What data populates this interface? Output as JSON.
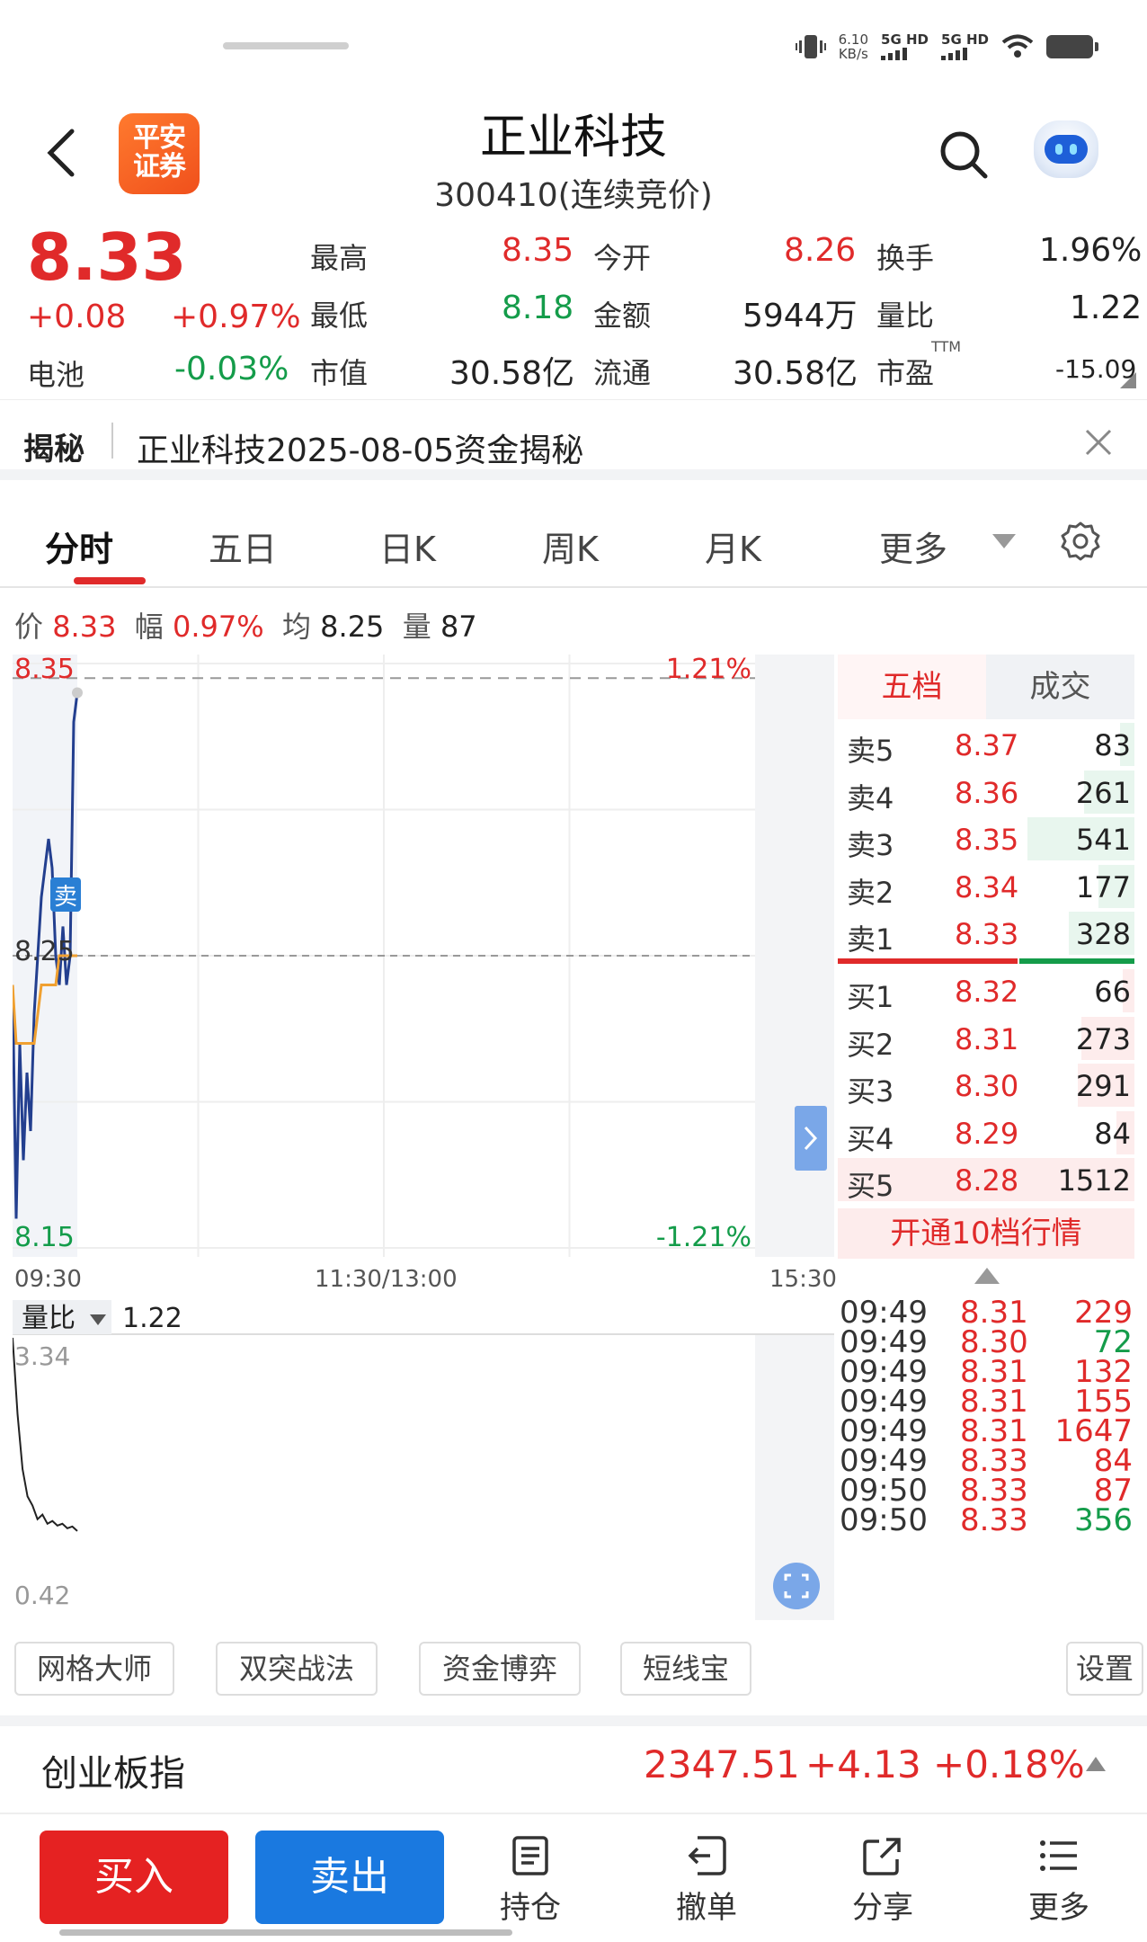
{
  "status": {
    "speed_value": "6.10",
    "speed_unit": "KB/s",
    "net1": "5G HD",
    "net2": "5G HD"
  },
  "header": {
    "logo_text_1": "平安",
    "logo_text_2": "证券",
    "title": "正业科技",
    "subtitle": "300410(连续竞价)"
  },
  "quote": {
    "price": "8.33",
    "change": "+0.08",
    "change_pct": "+0.97%",
    "battery_label": "电池",
    "battery_value": "-0.03%",
    "high_label": "最高",
    "high": "8.35",
    "low_label": "最低",
    "low": "8.18",
    "mcap_label": "市值",
    "mcap": "30.58亿",
    "open_label": "今开",
    "open": "8.26",
    "amount_label": "金额",
    "amount": "5944万",
    "float_label": "流通",
    "float": "30.58亿",
    "turnover_label": "换手",
    "turnover": "1.96%",
    "vol_ratio_label": "量比",
    "vol_ratio": "1.22",
    "pe_label": "市盈",
    "pe_sup": "TTM",
    "pe": "-15.09"
  },
  "banner": {
    "tag": "揭秘",
    "text": "正业科技2025-08-05资金揭秘"
  },
  "tabs": [
    "分时",
    "五日",
    "日K",
    "周K",
    "月K",
    "更多"
  ],
  "infoline": {
    "price_label": "价",
    "price": "8.33",
    "amp_label": "幅",
    "amp": "0.97%",
    "avg_label": "均",
    "avg": "8.25",
    "vol_label": "量",
    "vol": "87"
  },
  "chart_data": {
    "type": "line",
    "title": "",
    "y_range": [
      8.15,
      8.35
    ],
    "y_top_label": "8.35",
    "y_mid_label": "8.25",
    "y_bot_label": "8.15",
    "pct_top_label": "1.21%",
    "pct_bot_label": "-1.21%",
    "x_labels": [
      "09:30",
      "11:30/13:00",
      "15:30"
    ],
    "sell_marker": "卖",
    "series": [
      {
        "values": [
          8.24,
          8.16,
          8.22,
          8.18,
          8.21,
          8.19,
          8.23,
          8.25,
          8.27,
          8.28,
          8.29,
          8.28,
          8.25,
          8.24,
          8.26,
          8.24,
          8.25,
          8.33,
          8.34
        ]
      },
      {
        "values": [
          8.24,
          8.22,
          8.22,
          8.22,
          8.22,
          8.22,
          8.22,
          8.23,
          8.24,
          8.24,
          8.24,
          8.24,
          8.24,
          8.25,
          8.25,
          8.25,
          8.25,
          8.25,
          8.25
        ]
      }
    ]
  },
  "vol_chart": {
    "label": "量比",
    "value": "1.22",
    "top": "3.34",
    "bottom": "0.42",
    "range": [
      0.42,
      3.34
    ],
    "values": [
      3.34,
      2.5,
      1.9,
      1.6,
      1.5,
      1.35,
      1.4,
      1.3,
      1.33,
      1.28,
      1.3,
      1.25,
      1.27,
      1.22
    ]
  },
  "orderbook": {
    "tabs": [
      "五档",
      "成交"
    ],
    "asks": [
      {
        "label": "卖5",
        "price": "8.37",
        "vol": "83",
        "depth": 0.05
      },
      {
        "label": "卖4",
        "price": "8.36",
        "vol": "261",
        "depth": 0.17
      },
      {
        "label": "卖3",
        "price": "8.35",
        "vol": "541",
        "depth": 0.36
      },
      {
        "label": "卖2",
        "price": "8.34",
        "vol": "177",
        "depth": 0.12
      },
      {
        "label": "卖1",
        "price": "8.33",
        "vol": "328",
        "depth": 0.22
      }
    ],
    "bids": [
      {
        "label": "买1",
        "price": "8.32",
        "vol": "66",
        "depth": 0.04
      },
      {
        "label": "买2",
        "price": "8.31",
        "vol": "273",
        "depth": 0.18
      },
      {
        "label": "买3",
        "price": "8.30",
        "vol": "291",
        "depth": 0.19
      },
      {
        "label": "买4",
        "price": "8.29",
        "vol": "84",
        "depth": 0.06
      },
      {
        "label": "买5",
        "price": "8.28",
        "vol": "1512",
        "depth": 1.0
      }
    ],
    "open10": "开通10档行情"
  },
  "trades": [
    {
      "time": "09:49",
      "price": "8.31",
      "vol": "229",
      "color": "#e02a2a"
    },
    {
      "time": "09:49",
      "price": "8.30",
      "vol": "72",
      "color": "#149c4a"
    },
    {
      "time": "09:49",
      "price": "8.31",
      "vol": "132",
      "color": "#e02a2a"
    },
    {
      "time": "09:49",
      "price": "8.31",
      "vol": "155",
      "color": "#e02a2a"
    },
    {
      "time": "09:49",
      "price": "8.31",
      "vol": "1647",
      "color": "#e02a2a"
    },
    {
      "time": "09:49",
      "price": "8.33",
      "vol": "84",
      "color": "#e02a2a"
    },
    {
      "time": "09:50",
      "price": "8.33",
      "vol": "87",
      "color": "#e02a2a"
    },
    {
      "time": "09:50",
      "price": "8.33",
      "vol": "356",
      "color": "#149c4a"
    }
  ],
  "tools": [
    "网格大师",
    "双突战法",
    "资金博弈",
    "短线宝",
    "设置"
  ],
  "index": {
    "name": "创业板指",
    "value": "2347.51",
    "change": "+4.13",
    "change_pct": "+0.18%"
  },
  "bottom": {
    "buy": "买入",
    "sell": "卖出",
    "hold": "持仓",
    "cancel": "撤单",
    "share": "分享",
    "more": "更多"
  }
}
